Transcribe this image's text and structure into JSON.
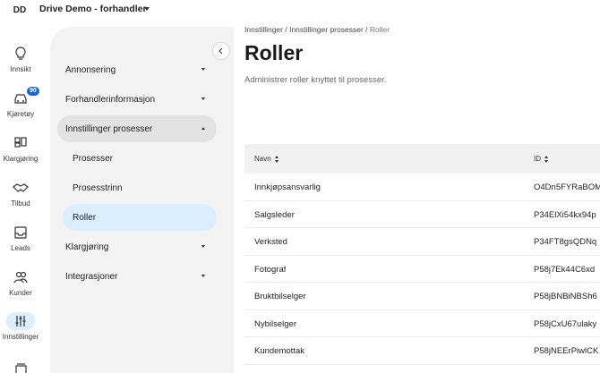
{
  "topbar": {
    "avatar_initials": "DD",
    "org_name": "Drive Demo - forhandler"
  },
  "rail": {
    "items": [
      {
        "label": "Innsikt",
        "icon": "lightbulb-icon"
      },
      {
        "label": "Kjøretøy",
        "icon": "car-icon",
        "badge": "90"
      },
      {
        "label": "Klargjøring",
        "icon": "board-icon"
      },
      {
        "label": "Tilbud",
        "icon": "handshake-icon"
      },
      {
        "label": "Leads",
        "icon": "inbox-icon"
      },
      {
        "label": "Kunder",
        "icon": "people-icon"
      },
      {
        "label": "Innstillinger",
        "icon": "sliders-icon",
        "active": true
      }
    ]
  },
  "subnav": {
    "items": [
      {
        "label": "Annonsering",
        "caret": "down"
      },
      {
        "label": "Forhandlerinformasjon",
        "caret": "down"
      },
      {
        "label": "Innstillinger prosesser",
        "caret": "up",
        "expanded": true
      },
      {
        "label": "Prosesser"
      },
      {
        "label": "Prosesstrinn"
      },
      {
        "label": "Roller",
        "selected": true
      },
      {
        "label": "Klargjøring",
        "caret": "down"
      },
      {
        "label": "Integrasjoner",
        "caret": "down"
      }
    ]
  },
  "breadcrumb": {
    "part1": "Innstillinger",
    "sep1": " / ",
    "part2": "Innstillinger prosesser",
    "sep2": " / ",
    "current": "Roller"
  },
  "page": {
    "title": "Roller",
    "description": "Administrer roller knyttet til prosesser."
  },
  "table": {
    "columns": [
      "Navn",
      "ID"
    ],
    "rows": [
      {
        "name": "Innkjøpsansvarlig",
        "id": "O4Dn5FYRaBOM"
      },
      {
        "name": "Salgsleder",
        "id": "P34ElXi54kx94p"
      },
      {
        "name": "Verksted",
        "id": "P34FT8gsQDNq"
      },
      {
        "name": "Fotograf",
        "id": "P58j7Ek44C6xd"
      },
      {
        "name": "Bruktbilselger",
        "id": "P58jBNBiNBSh6"
      },
      {
        "name": "Nybilselger",
        "id": "P58jCxU67ulaky"
      },
      {
        "name": "Kundemottak",
        "id": "P58jNEErPiwlCK"
      }
    ]
  }
}
